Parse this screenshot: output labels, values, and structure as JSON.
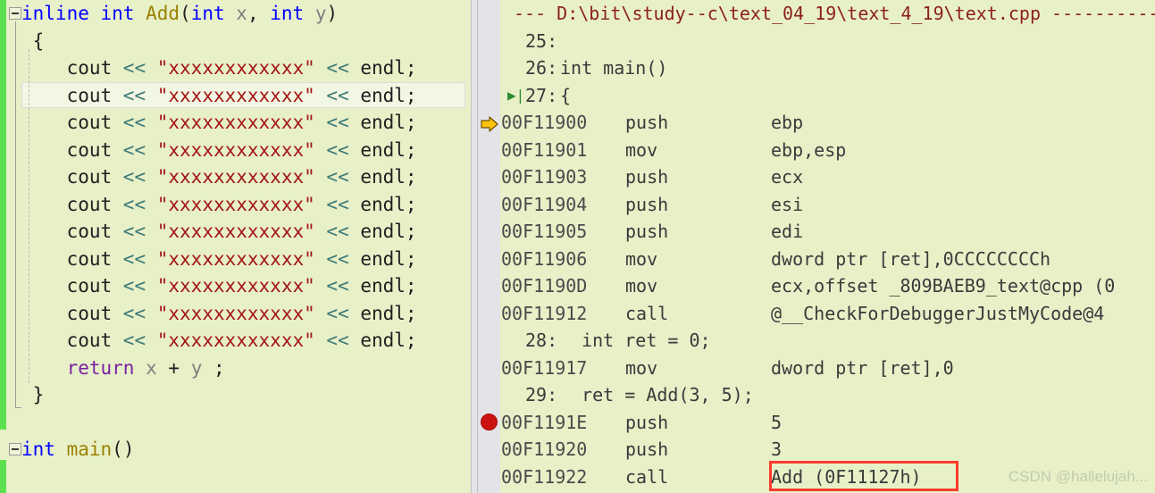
{
  "editor": {
    "name": "source-code-editor",
    "language": "cpp",
    "background_color": "#e8f0c8",
    "change_bar_color": "#5de04f",
    "current_line_index": 3,
    "lines": [
      {
        "indent": 0,
        "tokens": [
          {
            "t": "inline",
            "c": "kw"
          },
          {
            "t": " ",
            "c": "plain"
          },
          {
            "t": "int",
            "c": "kw"
          },
          {
            "t": " ",
            "c": "plain"
          },
          {
            "t": "Add",
            "c": "fname"
          },
          {
            "t": "(",
            "c": "plain"
          },
          {
            "t": "int",
            "c": "kw"
          },
          {
            "t": " ",
            "c": "plain"
          },
          {
            "t": "x",
            "c": "ident"
          },
          {
            "t": ", ",
            "c": "plain"
          },
          {
            "t": "int",
            "c": "kw"
          },
          {
            "t": " ",
            "c": "plain"
          },
          {
            "t": "y",
            "c": "ident"
          },
          {
            "t": ")",
            "c": "plain"
          }
        ]
      },
      {
        "indent": 0,
        "tokens": [
          {
            "t": " {",
            "c": "plain"
          }
        ]
      },
      {
        "indent": 1,
        "tokens": [
          {
            "t": "    cout ",
            "c": "plain"
          },
          {
            "t": "<<",
            "c": "op"
          },
          {
            "t": " ",
            "c": "plain"
          },
          {
            "t": "\"xxxxxxxxxxxx\"",
            "c": "str"
          },
          {
            "t": " ",
            "c": "plain"
          },
          {
            "t": "<<",
            "c": "op"
          },
          {
            "t": " endl;",
            "c": "plain"
          }
        ]
      },
      {
        "indent": 1,
        "tokens": [
          {
            "t": "    cout ",
            "c": "plain"
          },
          {
            "t": "<<",
            "c": "op"
          },
          {
            "t": " ",
            "c": "plain"
          },
          {
            "t": "\"xxxxxxxxxxxx\"",
            "c": "str"
          },
          {
            "t": " ",
            "c": "plain"
          },
          {
            "t": "<<",
            "c": "op"
          },
          {
            "t": " endl;",
            "c": "plain"
          }
        ]
      },
      {
        "indent": 1,
        "tokens": [
          {
            "t": "    cout ",
            "c": "plain"
          },
          {
            "t": "<<",
            "c": "op"
          },
          {
            "t": " ",
            "c": "plain"
          },
          {
            "t": "\"xxxxxxxxxxxx\"",
            "c": "str"
          },
          {
            "t": " ",
            "c": "plain"
          },
          {
            "t": "<<",
            "c": "op"
          },
          {
            "t": " endl;",
            "c": "plain"
          }
        ]
      },
      {
        "indent": 1,
        "tokens": [
          {
            "t": "    cout ",
            "c": "plain"
          },
          {
            "t": "<<",
            "c": "op"
          },
          {
            "t": " ",
            "c": "plain"
          },
          {
            "t": "\"xxxxxxxxxxxx\"",
            "c": "str"
          },
          {
            "t": " ",
            "c": "plain"
          },
          {
            "t": "<<",
            "c": "op"
          },
          {
            "t": " endl;",
            "c": "plain"
          }
        ]
      },
      {
        "indent": 1,
        "tokens": [
          {
            "t": "    cout ",
            "c": "plain"
          },
          {
            "t": "<<",
            "c": "op"
          },
          {
            "t": " ",
            "c": "plain"
          },
          {
            "t": "\"xxxxxxxxxxxx\"",
            "c": "str"
          },
          {
            "t": " ",
            "c": "plain"
          },
          {
            "t": "<<",
            "c": "op"
          },
          {
            "t": " endl;",
            "c": "plain"
          }
        ]
      },
      {
        "indent": 1,
        "tokens": [
          {
            "t": "    cout ",
            "c": "plain"
          },
          {
            "t": "<<",
            "c": "op"
          },
          {
            "t": " ",
            "c": "plain"
          },
          {
            "t": "\"xxxxxxxxxxxx\"",
            "c": "str"
          },
          {
            "t": " ",
            "c": "plain"
          },
          {
            "t": "<<",
            "c": "op"
          },
          {
            "t": " endl;",
            "c": "plain"
          }
        ]
      },
      {
        "indent": 1,
        "tokens": [
          {
            "t": "    cout ",
            "c": "plain"
          },
          {
            "t": "<<",
            "c": "op"
          },
          {
            "t": " ",
            "c": "plain"
          },
          {
            "t": "\"xxxxxxxxxxxx\"",
            "c": "str"
          },
          {
            "t": " ",
            "c": "plain"
          },
          {
            "t": "<<",
            "c": "op"
          },
          {
            "t": " endl;",
            "c": "plain"
          }
        ]
      },
      {
        "indent": 1,
        "tokens": [
          {
            "t": "    cout ",
            "c": "plain"
          },
          {
            "t": "<<",
            "c": "op"
          },
          {
            "t": " ",
            "c": "plain"
          },
          {
            "t": "\"xxxxxxxxxxxx\"",
            "c": "str"
          },
          {
            "t": " ",
            "c": "plain"
          },
          {
            "t": "<<",
            "c": "op"
          },
          {
            "t": " endl;",
            "c": "plain"
          }
        ]
      },
      {
        "indent": 1,
        "tokens": [
          {
            "t": "    cout ",
            "c": "plain"
          },
          {
            "t": "<<",
            "c": "op"
          },
          {
            "t": " ",
            "c": "plain"
          },
          {
            "t": "\"xxxxxxxxxxxx\"",
            "c": "str"
          },
          {
            "t": " ",
            "c": "plain"
          },
          {
            "t": "<<",
            "c": "op"
          },
          {
            "t": " endl;",
            "c": "plain"
          }
        ]
      },
      {
        "indent": 1,
        "tokens": [
          {
            "t": "    cout ",
            "c": "plain"
          },
          {
            "t": "<<",
            "c": "op"
          },
          {
            "t": " ",
            "c": "plain"
          },
          {
            "t": "\"xxxxxxxxxxxx\"",
            "c": "str"
          },
          {
            "t": " ",
            "c": "plain"
          },
          {
            "t": "<<",
            "c": "op"
          },
          {
            "t": " endl;",
            "c": "plain"
          }
        ]
      },
      {
        "indent": 1,
        "tokens": [
          {
            "t": "    cout ",
            "c": "plain"
          },
          {
            "t": "<<",
            "c": "op"
          },
          {
            "t": " ",
            "c": "plain"
          },
          {
            "t": "\"xxxxxxxxxxxx\"",
            "c": "str"
          },
          {
            "t": " ",
            "c": "plain"
          },
          {
            "t": "<<",
            "c": "op"
          },
          {
            "t": " endl;",
            "c": "plain"
          }
        ]
      },
      {
        "indent": 1,
        "tokens": [
          {
            "t": "    ",
            "c": "plain"
          },
          {
            "t": "return",
            "c": "kw2"
          },
          {
            "t": " ",
            "c": "plain"
          },
          {
            "t": "x",
            "c": "ident"
          },
          {
            "t": " + ",
            "c": "plain"
          },
          {
            "t": "y",
            "c": "ident"
          },
          {
            "t": " ;",
            "c": "plain"
          }
        ]
      },
      {
        "indent": 0,
        "tokens": [
          {
            "t": " }",
            "c": "plain"
          }
        ]
      },
      {
        "indent": 0,
        "tokens": [
          {
            "t": "",
            "c": "plain"
          }
        ]
      },
      {
        "indent": 0,
        "tokens": [
          {
            "t": "int",
            "c": "kw"
          },
          {
            "t": " ",
            "c": "plain"
          },
          {
            "t": "main",
            "c": "fname"
          },
          {
            "t": "()",
            "c": "plain"
          }
        ]
      }
    ],
    "fold_markers": [
      {
        "name": "fold-toggle-add-function",
        "line": 0,
        "state": "expanded"
      },
      {
        "name": "fold-toggle-main-function",
        "line": 16,
        "state": "expanded"
      }
    ]
  },
  "disassembly": {
    "name": "disassembly-window",
    "source_file_header": "--- D:\\bit\\study--c\\text_04_19\\text_4_19\\text.cpp ---------------",
    "call_target_highlight_color": "#ff3b30",
    "rows": [
      {
        "kind": "header",
        "text": "--- D:\\bit\\study--c\\text_04_19\\text_4_19\\text.cpp ---------------"
      },
      {
        "kind": "source",
        "lineno": "25:",
        "text": ""
      },
      {
        "kind": "source",
        "lineno": "26:",
        "text": "int main()"
      },
      {
        "kind": "source",
        "lineno": "27:",
        "text": "{",
        "marker": "step-marker"
      },
      {
        "kind": "asm",
        "addr": "00F11900",
        "mnem": "push",
        "oper": "ebp",
        "marker": "instruction-pointer"
      },
      {
        "kind": "asm",
        "addr": "00F11901",
        "mnem": "mov",
        "oper": "ebp,esp"
      },
      {
        "kind": "asm",
        "addr": "00F11903",
        "mnem": "push",
        "oper": "ecx"
      },
      {
        "kind": "asm",
        "addr": "00F11904",
        "mnem": "push",
        "oper": "esi"
      },
      {
        "kind": "asm",
        "addr": "00F11905",
        "mnem": "push",
        "oper": "edi"
      },
      {
        "kind": "asm",
        "addr": "00F11906",
        "mnem": "mov",
        "oper": "dword ptr [ret],0CCCCCCCCh"
      },
      {
        "kind": "asm",
        "addr": "00F1190D",
        "mnem": "mov",
        "oper": "ecx,offset _809BAEB9_text@cpp (0"
      },
      {
        "kind": "asm",
        "addr": "00F11912",
        "mnem": "call",
        "oper": "@__CheckForDebuggerJustMyCode@4"
      },
      {
        "kind": "source",
        "lineno": "28:",
        "text": "  int ret = 0;"
      },
      {
        "kind": "asm",
        "addr": "00F11917",
        "mnem": "mov",
        "oper": "dword ptr [ret],0"
      },
      {
        "kind": "source",
        "lineno": "29:",
        "text": "  ret = Add(3, 5);"
      },
      {
        "kind": "asm",
        "addr": "00F1191E",
        "mnem": "push",
        "oper": "5",
        "marker": "breakpoint"
      },
      {
        "kind": "asm",
        "addr": "00F11920",
        "mnem": "push",
        "oper": "3"
      },
      {
        "kind": "asm",
        "addr": "00F11922",
        "mnem": "call",
        "oper": "Add (0F11127h)",
        "highlight": true
      }
    ]
  },
  "watermark": {
    "text": "CSDN @hallelujah..."
  }
}
